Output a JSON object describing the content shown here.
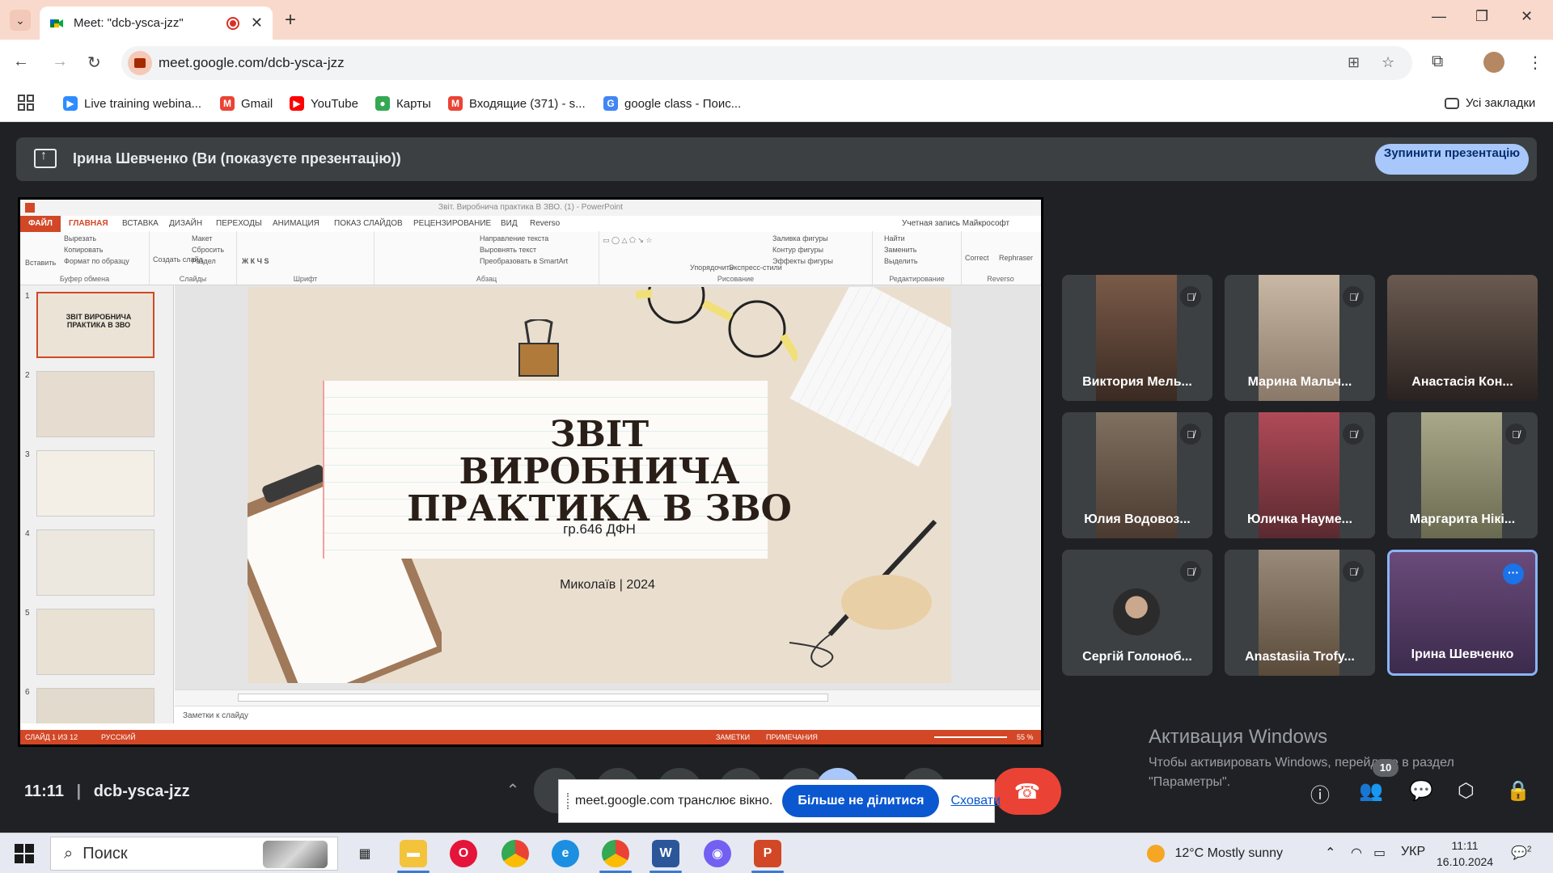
{
  "browser": {
    "tab_title": "Meet: \"dcb-ysca-jzz\"",
    "url": "meet.google.com/dcb-ysca-jzz",
    "bookmarks": [
      {
        "label": "Live training webina...",
        "icon": "zoom-icon",
        "color": "#2d8cff"
      },
      {
        "label": "Gmail",
        "icon": "gmail-icon",
        "color": "#ea4335"
      },
      {
        "label": "YouTube",
        "icon": "youtube-icon",
        "color": "#ff0000"
      },
      {
        "label": "Карты",
        "icon": "maps-icon",
        "color": "#34a853"
      },
      {
        "label": "Входящие (371) - s...",
        "icon": "gmail-icon",
        "color": "#ea4335"
      },
      {
        "label": "google class - Поис...",
        "icon": "google-icon",
        "color": "#4285f4"
      }
    ],
    "all_bookmarks": "Усі закладки"
  },
  "meet": {
    "presenting_text": "Ірина Шевченко (Ви (показуєте презентацію))",
    "stop_presenting": "Зупинити презентацію",
    "time": "11:11",
    "code": "dcb-ysca-jzz",
    "participants_count": "10",
    "participants": [
      {
        "name": "Виктория Мель...",
        "muted": true,
        "video": "#7a5a48"
      },
      {
        "name": "Марина Мальч...",
        "muted": true,
        "video": "#b8a894"
      },
      {
        "name": "Анастасія Кон...",
        "muted": false,
        "video": "#5a4a40"
      },
      {
        "name": "Юлия Водовоз...",
        "muted": true,
        "video": "#6f6050"
      },
      {
        "name": "Юличка Науме...",
        "muted": true,
        "video": "#8a3a48"
      },
      {
        "name": "Маргарита Нікі...",
        "muted": true,
        "video": "#9a9a7a"
      },
      {
        "name": "Сергій Голоноб...",
        "muted": true,
        "video": "#3c4043"
      },
      {
        "name": "Anastasiia Trofy...",
        "muted": true,
        "video": "#8a7a6a"
      },
      {
        "name": "Ірина Шевченко",
        "muted": false,
        "video": "#5a3a6a"
      }
    ],
    "share_note": {
      "message": "meet.google.com транслює вікно.",
      "stop": "Більше не ділитися",
      "hide": "Сховати"
    }
  },
  "ppt": {
    "window_title": "Звіт. Виробнича практика В ЗВО. (1) - PowerPoint",
    "account": "Учетная запись Майкрософт",
    "tabs": [
      "ФАЙЛ",
      "ГЛАВНАЯ",
      "ВСТАВКА",
      "ДИЗАЙН",
      "ПЕРЕХОДЫ",
      "АНИМАЦИЯ",
      "ПОКАЗ СЛАЙДОВ",
      "РЕЦЕНЗИРОВАНИЕ",
      "ВИД",
      "Reverso"
    ],
    "groups": [
      "Буфер обмена",
      "Слайды",
      "Шрифт",
      "Абзац",
      "Рисование",
      "Редактирование",
      "Reverso"
    ],
    "ribbon_items": {
      "paste": "Вставить",
      "cut": "Вырезать",
      "copy": "Копировать",
      "format": "Формат по образцу",
      "new_slide": "Создать слайд",
      "layout": "Макет",
      "reset": "Сбросить",
      "section": "Раздел",
      "text_dir": "Направление текста",
      "align_text": "Выровнять текст",
      "smartart": "Преобразовать в SmartArt",
      "arrange": "Упорядочить",
      "quick_styles": "Экспресс-стили",
      "fill": "Заливка фигуры",
      "outline": "Контур фигуры",
      "effects": "Эффекты фигуры",
      "find": "Найти",
      "replace": "Заменить",
      "select": "Выделить",
      "correct": "Correct",
      "rephraser": "Rephraser"
    },
    "thumb_count": [
      "1",
      "2",
      "3",
      "4",
      "5",
      "6"
    ],
    "thumb1_text": "ЗВІТ ВИРОБНИЧА ПРАКТИКА В ЗВО",
    "slide": {
      "title_line1": "ЗВІТ",
      "title_line2": "ВИРОБНИЧА",
      "title_line3": "ПРАКТИКА В ЗВО",
      "subtitle": "гр.646 ДФН",
      "footer": "Миколаїв | 2024"
    },
    "notes": "Заметки к слайду",
    "status_slide": "СЛАЙД 1 ИЗ 12",
    "status_lang": "РУССКИЙ",
    "status_notes": "ЗАМЕТКИ",
    "status_comments": "ПРИМЕЧАНИЯ",
    "zoom": "55 %"
  },
  "windows": {
    "activation_title": "Активация Windows",
    "activation_text1": "Чтобы активировать Windows, перейдите в раздел",
    "activation_text2": "\"Параметры\".",
    "search": "Поиск",
    "weather": "12°C  Mostly sunny",
    "lang": "УКР",
    "time": "11:11",
    "date": "16.10.2024",
    "notif_count": "2"
  }
}
